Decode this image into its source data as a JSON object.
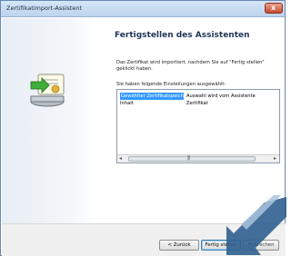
{
  "window": {
    "title": "Zertifikatimport-Assistent",
    "close_symbol": "x"
  },
  "main": {
    "heading": "Fertigstellen des Assistenten",
    "description": "Das Zertifikat wird importiert, nachdem Sie auf \"Fertig stellen\" geklickt haben.",
    "settings_label": "Sie haben folgende Einstellungen ausgewählt:",
    "settings_rows": [
      {
        "name": "Gewählter Zertifikatspeicher",
        "value": "Auswahl wird vom Assistente",
        "selected": true
      },
      {
        "name": "Inhalt",
        "value": "Zertifikat",
        "selected": false
      }
    ],
    "scrollbar": {
      "left_arrow": "◂",
      "right_arrow": "▸",
      "grip": "|||"
    }
  },
  "footer": {
    "back_label": "< Zurück",
    "finish_label": "Fertig stellen",
    "cancel_label": "Abbrechen"
  },
  "colors": {
    "selection": "#3399ff",
    "heading": "#1e3556",
    "overlay_arrow": "#2f5f8f"
  },
  "icons": [
    "wizard-certificate-icon",
    "close-icon",
    "annotation-arrow"
  ]
}
